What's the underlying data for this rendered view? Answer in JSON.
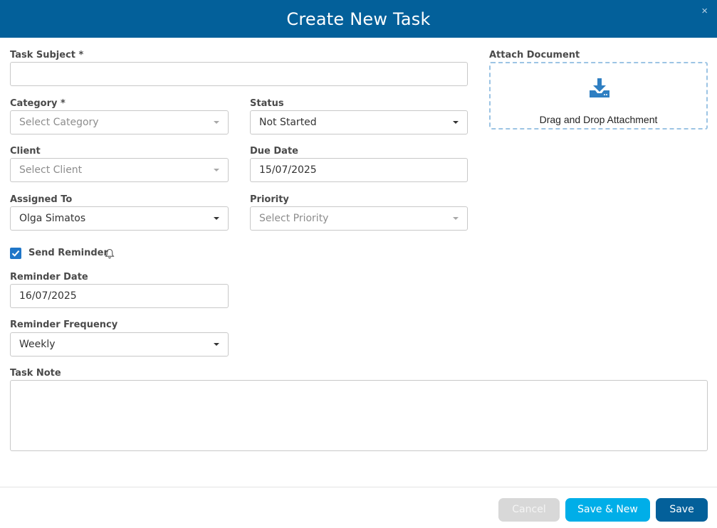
{
  "header": {
    "title": "Create New Task",
    "close_glyph": "×"
  },
  "form": {
    "task_subject": {
      "label": "Task Subject *",
      "value": ""
    },
    "attach": {
      "label": "Attach Document",
      "drop_text": "Drag and Drop Attachment",
      "icon": "download-tray-icon"
    },
    "category": {
      "label": "Category *",
      "placeholder": "Select Category"
    },
    "status": {
      "label": "Status",
      "value": "Not Started"
    },
    "client": {
      "label": "Client",
      "placeholder": "Select Client"
    },
    "due_date": {
      "label": "Due Date",
      "value": "15/07/2025"
    },
    "assigned_to": {
      "label": "Assigned To",
      "value": "Olga Simatos"
    },
    "priority": {
      "label": "Priority",
      "placeholder": "Select Priority"
    },
    "send_reminder": {
      "label": "Send Reminder",
      "checked": true,
      "icon": "bell-icon"
    },
    "reminder_date": {
      "label": "Reminder Date",
      "value": "16/07/2025"
    },
    "reminder_frequency": {
      "label": "Reminder Frequency",
      "value": "Weekly"
    },
    "task_note": {
      "label": "Task Note",
      "value": ""
    }
  },
  "footer": {
    "cancel_label": "Cancel",
    "save_new_label": "Save & New",
    "save_label": "Save"
  },
  "colors": {
    "header": "#03609a",
    "checkbox": "#1f76c8",
    "save_new": "#00aee8",
    "cancel": "#d8d8d8",
    "attach_border": "#9cc4e4"
  }
}
